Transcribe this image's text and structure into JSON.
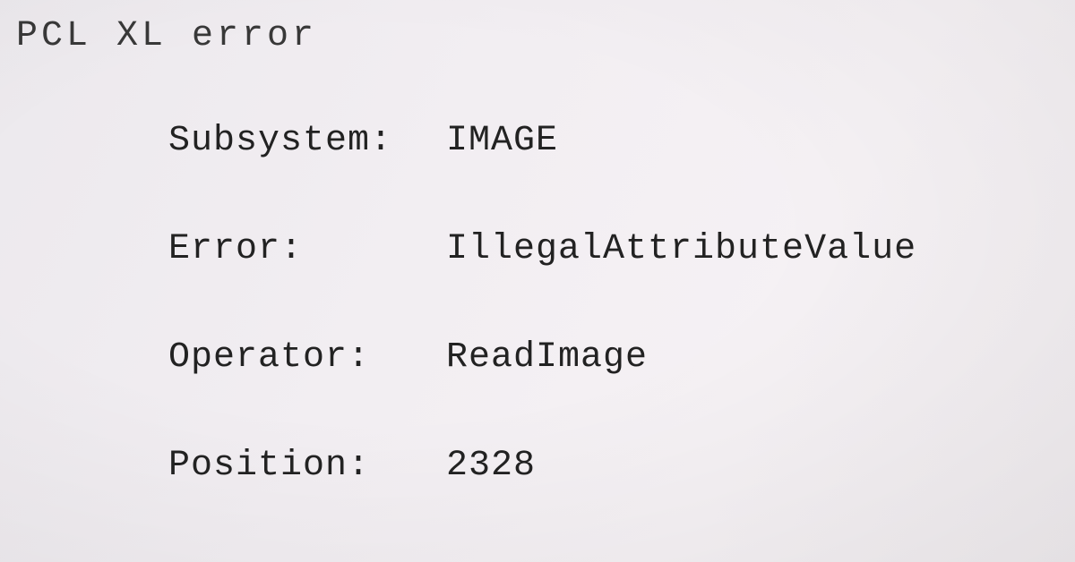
{
  "title": "PCL XL error",
  "fields": {
    "subsystem": {
      "label": "Subsystem:",
      "value": "IMAGE"
    },
    "error": {
      "label": "Error:",
      "value": "IllegalAttributeValue"
    },
    "operator": {
      "label": "Operator:",
      "value": "ReadImage"
    },
    "position": {
      "label": "Position:",
      "value": "2328"
    }
  }
}
